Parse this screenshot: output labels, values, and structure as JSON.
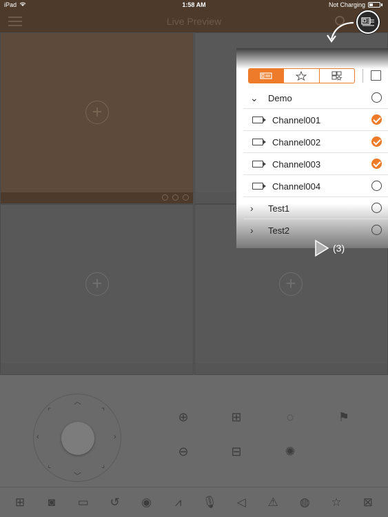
{
  "status_bar": {
    "device": "iPad",
    "time": "1:58 AM",
    "charging": "Not Charging"
  },
  "header": {
    "title": "Live Preview"
  },
  "grid": {
    "cells": 4
  },
  "panel": {
    "tabs": [
      {
        "name": "device-tab",
        "icon": "device-icon",
        "active": true
      },
      {
        "name": "favorites-tab",
        "icon": "star-folder-icon",
        "active": false
      },
      {
        "name": "group-tab",
        "icon": "grid-star-icon",
        "active": false
      }
    ],
    "rows": [
      {
        "type": "group",
        "expanded": true,
        "label": "Demo",
        "checked": false
      },
      {
        "type": "channel",
        "label": "Channel001",
        "checked": true
      },
      {
        "type": "channel",
        "label": "Channel002",
        "checked": true
      },
      {
        "type": "channel",
        "label": "Channel003",
        "checked": true
      },
      {
        "type": "channel",
        "label": "Channel004",
        "checked": false
      },
      {
        "type": "group",
        "expanded": false,
        "label": "Test1",
        "checked": false
      },
      {
        "type": "group",
        "expanded": false,
        "label": "Test2",
        "checked": false
      }
    ]
  },
  "annotation": {
    "step": "(3)"
  },
  "colors": {
    "accent": "#ee7b2a",
    "header": "#4d3a2a"
  }
}
